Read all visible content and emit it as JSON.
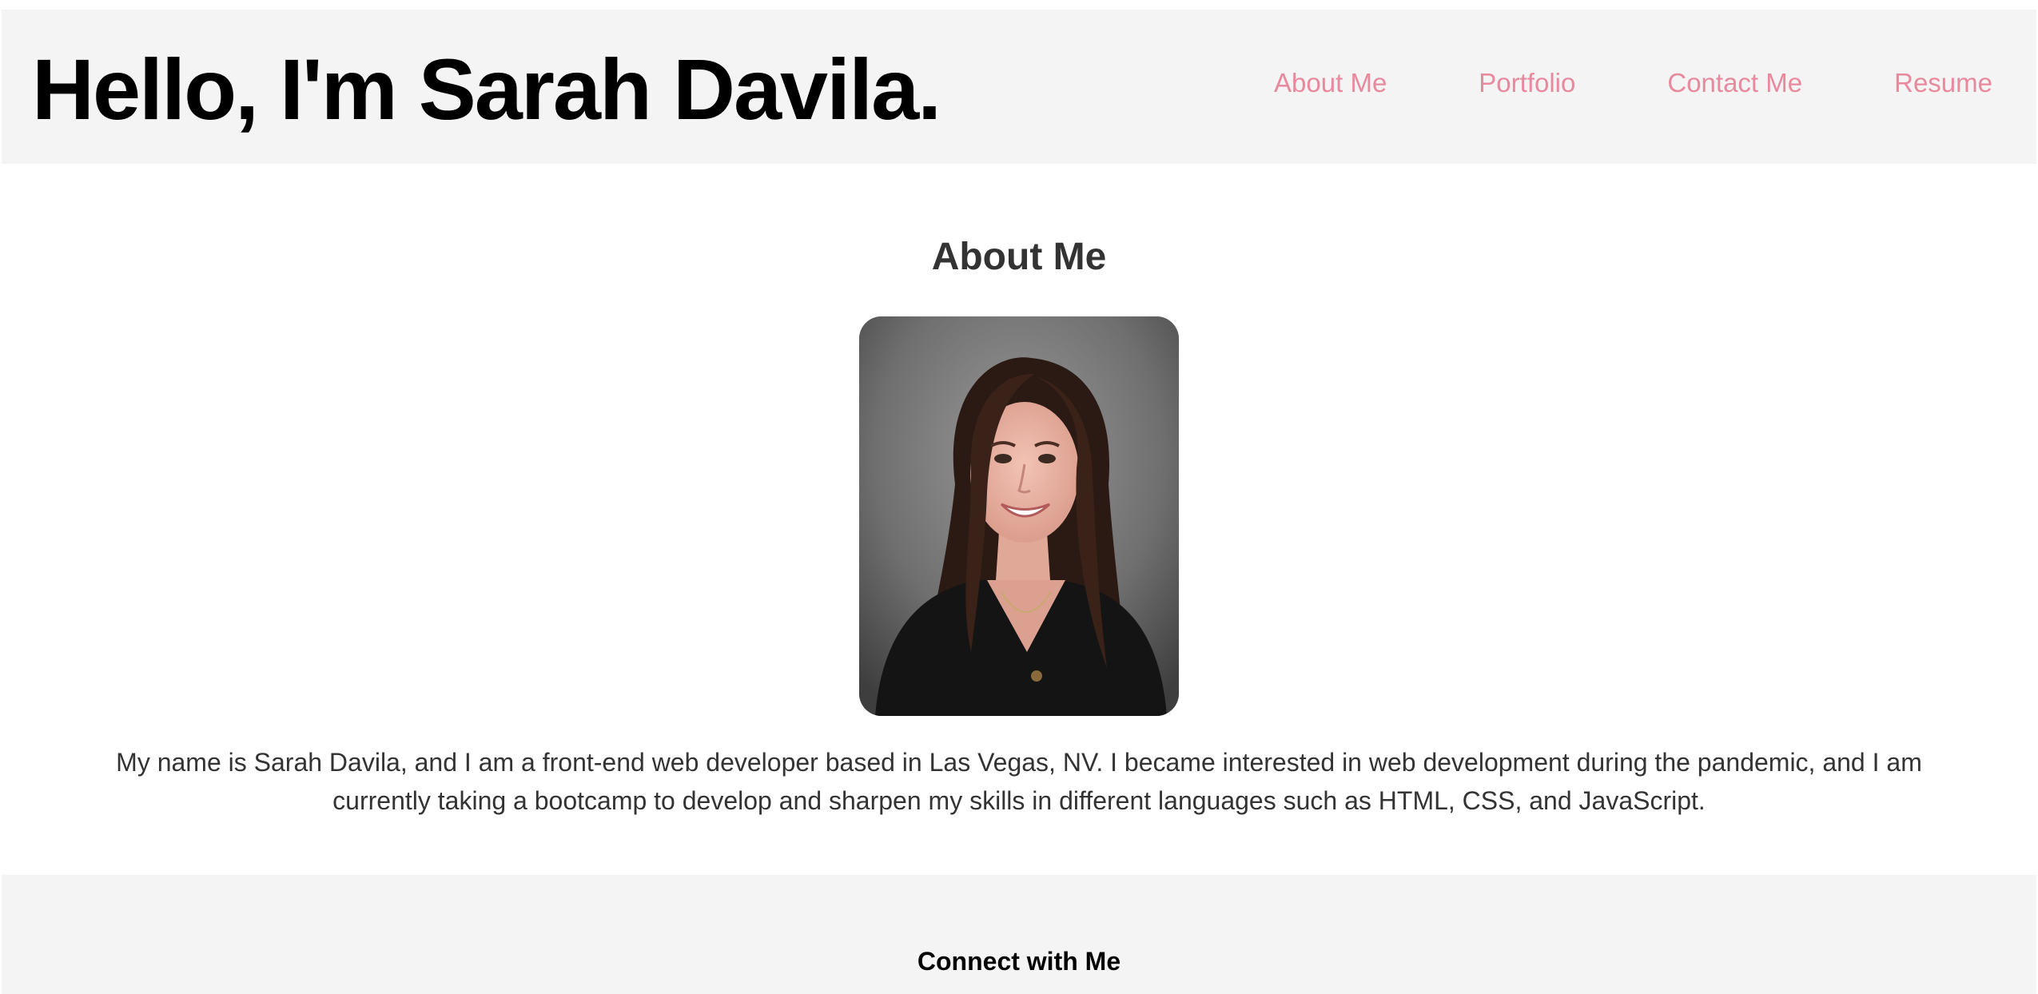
{
  "header": {
    "title": "Hello, I'm Sarah Davila.",
    "nav": [
      {
        "label": "About Me"
      },
      {
        "label": "Portfolio"
      },
      {
        "label": "Contact Me"
      },
      {
        "label": "Resume"
      }
    ]
  },
  "about": {
    "heading": "About Me",
    "bio": "My name is Sarah Davila, and I am a front-end web developer based in Las Vegas, NV. I became interested in web development during the pandemic, and I am currently taking a bootcamp to develop and sharpen my skills in different languages such as HTML, CSS, and JavaScript."
  },
  "footer": {
    "heading": "Connect with Me"
  },
  "colors": {
    "nav_link": "#e8899e",
    "header_bg": "#f3f4f3",
    "heading_text": "#333333"
  }
}
